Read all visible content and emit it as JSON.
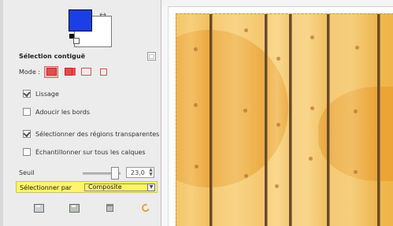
{
  "panel": {
    "section_title": "Sélection contiguë",
    "mode_label": "Mode :",
    "options": [
      {
        "label": "Lissage",
        "checked": true
      },
      {
        "label": "Adoucir les bords",
        "checked": false
      },
      {
        "label": "Sélectionner des régions transparentes",
        "checked": true
      },
      {
        "label": "Échantillonner sur tous les calques",
        "checked": false
      }
    ],
    "threshold_label": "Seuil",
    "threshold_value": "23,0",
    "select_label": "Sélectionner par",
    "select_value": "Composite"
  },
  "colors": {
    "foreground": "#1c3ee6",
    "background": "#ffffff",
    "highlight": "#fff36e"
  }
}
